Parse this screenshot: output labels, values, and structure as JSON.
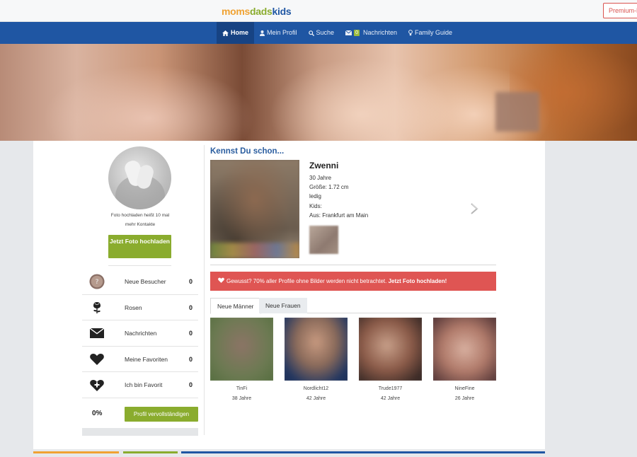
{
  "brand": {
    "logo_parts": [
      "moms",
      "dads",
      "kids"
    ],
    "logo_colors": [
      "#f0a232",
      "#8aac2e",
      "#1f56a3"
    ],
    "premium_label": "Premium-M"
  },
  "nav": {
    "items": [
      {
        "label": "Home",
        "icon": "home-icon",
        "active": true
      },
      {
        "label": "Mein Profil",
        "icon": "user-icon",
        "active": false
      },
      {
        "label": "Suche",
        "icon": "search-icon",
        "active": false
      },
      {
        "label": "Nachrichten",
        "icon": "envelope-icon",
        "badge": "0",
        "active": false
      },
      {
        "label": "Family Guide",
        "icon": "lightbulb-icon",
        "active": false
      }
    ]
  },
  "sidebar": {
    "photo_hint": "Foto hochladen heißt 10 mal mehr Kontakte",
    "upload_button": "Jetzt Foto hochladen",
    "stats": [
      {
        "icon": "visitor-avatar-icon",
        "label": "Neue Besucher",
        "value": "0"
      },
      {
        "icon": "rose-icon",
        "label": "Rosen",
        "value": "0"
      },
      {
        "icon": "envelope-icon",
        "label": "Nachrichten",
        "value": "0"
      },
      {
        "icon": "heart-icon",
        "label": "Meine Favoriten",
        "value": "0"
      },
      {
        "icon": "heart-plus-icon",
        "label": "Ich bin Favorit",
        "value": "0"
      }
    ],
    "completion_percent": "0%",
    "complete_button": "Profil vervollständigen"
  },
  "featured": {
    "heading": "Kennst Du schon...",
    "name": "Zwenni",
    "details": [
      "30 Jahre",
      "Größe: 1.72 cm",
      "ledig",
      "Kids:",
      "Aus: Frankfurt am Main"
    ]
  },
  "alert": {
    "text": "Gewusst? 70% aller Profile ohne Bilder werden nicht betrachtet.",
    "link": "Jetzt Foto hochladen!"
  },
  "tabs": [
    {
      "label": "Neue Männer",
      "active": true
    },
    {
      "label": "Neue Frauen",
      "active": false
    }
  ],
  "profiles": [
    {
      "name": "TinFi",
      "age": "38 Jahre"
    },
    {
      "name": "Nordlicht12",
      "age": "42 Jahre"
    },
    {
      "name": "Trude1977",
      "age": "42 Jahre"
    },
    {
      "name": "NineFine",
      "age": "26 Jahre"
    }
  ],
  "colors": {
    "nav_blue": "#1f56a3",
    "green": "#8aac2e",
    "alert_red": "#df5553",
    "heading_blue": "#2a5d9f"
  }
}
